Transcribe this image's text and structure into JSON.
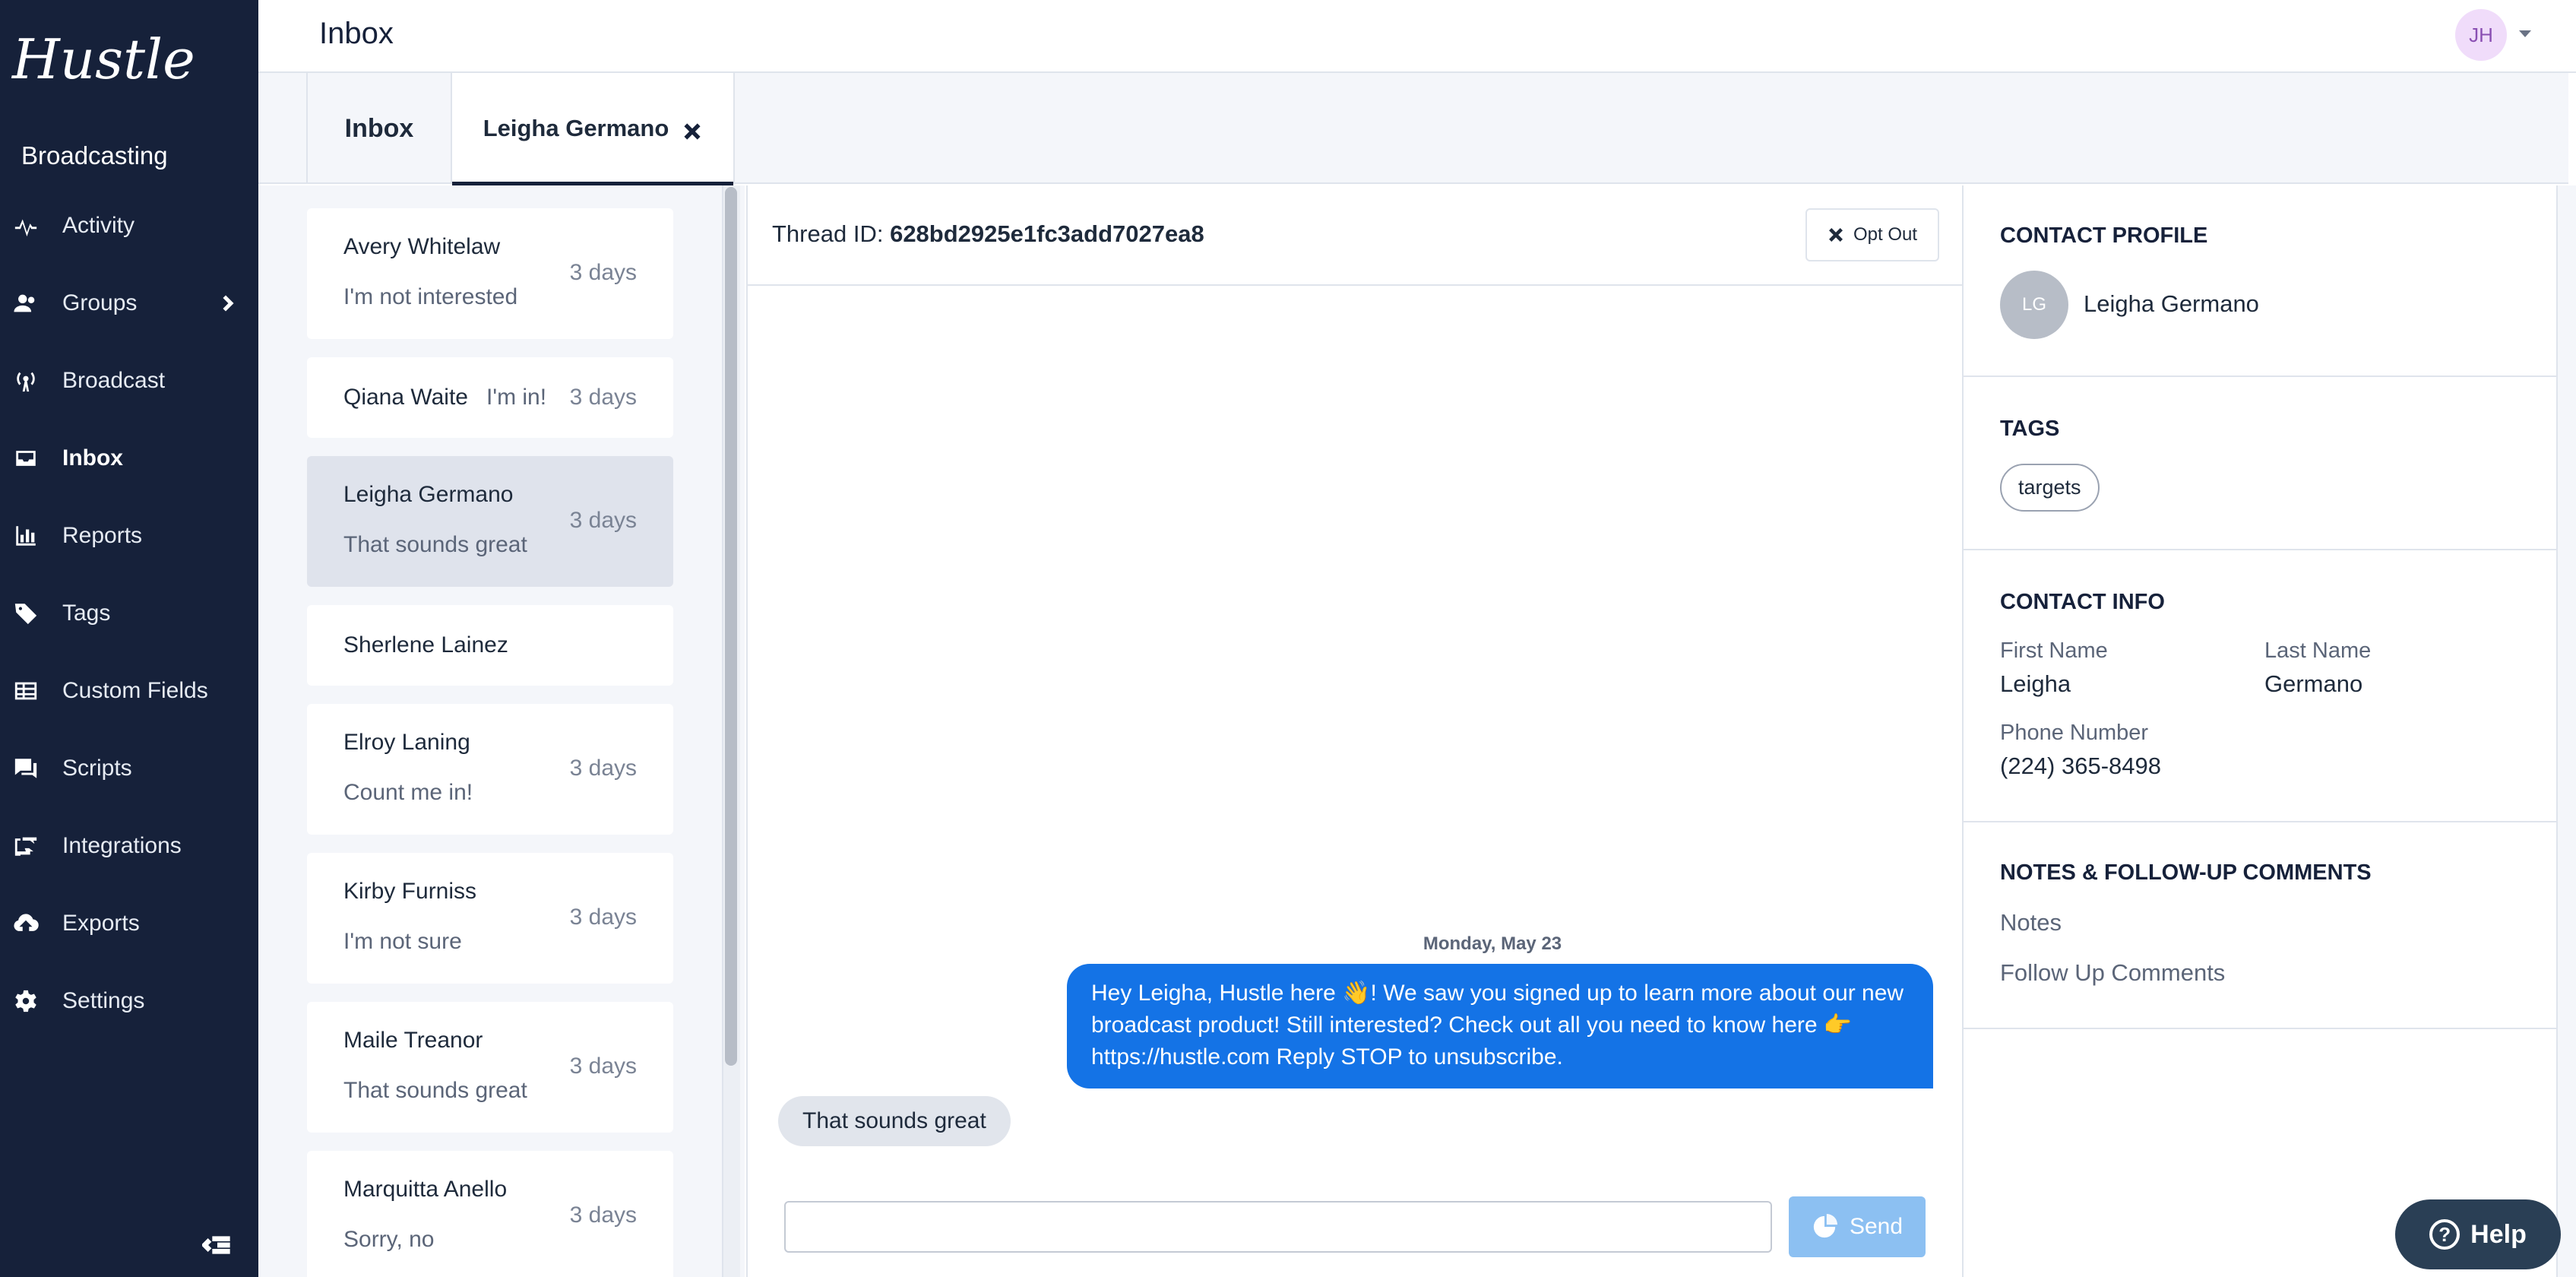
{
  "app": {
    "brand": "Hustle",
    "section": "Broadcasting"
  },
  "sidebar": {
    "items": [
      {
        "label": "Activity",
        "icon": "activity-icon"
      },
      {
        "label": "Groups",
        "icon": "groups-icon"
      },
      {
        "label": "Broadcast",
        "icon": "broadcast-icon"
      },
      {
        "label": "Inbox",
        "icon": "inbox-icon",
        "active": true
      },
      {
        "label": "Reports",
        "icon": "reports-icon"
      },
      {
        "label": "Tags",
        "icon": "tag-icon"
      },
      {
        "label": "Custom Fields",
        "icon": "custom-fields-icon"
      },
      {
        "label": "Scripts",
        "icon": "scripts-icon"
      },
      {
        "label": "Integrations",
        "icon": "integrations-icon"
      },
      {
        "label": "Exports",
        "icon": "exports-icon"
      },
      {
        "label": "Settings",
        "icon": "gear-icon"
      }
    ]
  },
  "header": {
    "title": "Inbox",
    "avatar_initials": "JH"
  },
  "tabs": [
    {
      "label": "Inbox"
    },
    {
      "label": "Leigha Germano"
    }
  ],
  "conversations": [
    {
      "name": "Avery Whitelaw",
      "preview": "I'm not interested",
      "time": "3 days"
    },
    {
      "name": "Qiana Waite",
      "preview": "I'm in!",
      "time": "3 days"
    },
    {
      "name": "Leigha Germano",
      "preview": "That sounds great",
      "time": "3 days",
      "selected": true
    },
    {
      "name": "Sherlene Lainez",
      "preview": "",
      "time": ""
    },
    {
      "name": "Elroy Laning",
      "preview": "Count me in!",
      "time": "3 days"
    },
    {
      "name": "Kirby Furniss",
      "preview": "I'm not sure",
      "time": "3 days"
    },
    {
      "name": "Maile Treanor",
      "preview": "That sounds great",
      "time": "3 days"
    },
    {
      "name": "Marquitta Anello",
      "preview": "Sorry, no",
      "time": "3 days"
    }
  ],
  "thread": {
    "id_label": "Thread ID:",
    "id_value": "628bd2925e1fc3add7027ea8",
    "opt_out_label": "Opt Out",
    "date_separator": "Monday, May 23",
    "outgoing_message": "Hey Leigha, Hustle here 👋! We saw you signed up to learn more about our new broadcast product! Still interested? Check out all you need to know here 👉 https://hustle.com Reply STOP to unsubscribe.",
    "incoming_message": "That sounds great",
    "composer_value": "",
    "send_label": "Send"
  },
  "profile": {
    "heading": "CONTACT PROFILE",
    "avatar_initials": "LG",
    "name": "Leigha Germano",
    "tags_heading": "TAGS",
    "tags": [
      "targets"
    ],
    "info_heading": "CONTACT INFO",
    "first_name_label": "First Name",
    "first_name": "Leigha",
    "last_name_label": "Last Name",
    "last_name": "Germano",
    "phone_label": "Phone Number",
    "phone": "(224) 365-8498",
    "notes_heading": "NOTES & FOLLOW-UP COMMENTS",
    "notes_label": "Notes",
    "follow_up_label": "Follow Up Comments"
  },
  "help": {
    "label": "Help"
  },
  "colors": {
    "sidebar_bg": "#16213a",
    "accent_blue": "#1473e6",
    "send_disabled": "#8cc0f2",
    "help_bg": "#2a3f55"
  }
}
